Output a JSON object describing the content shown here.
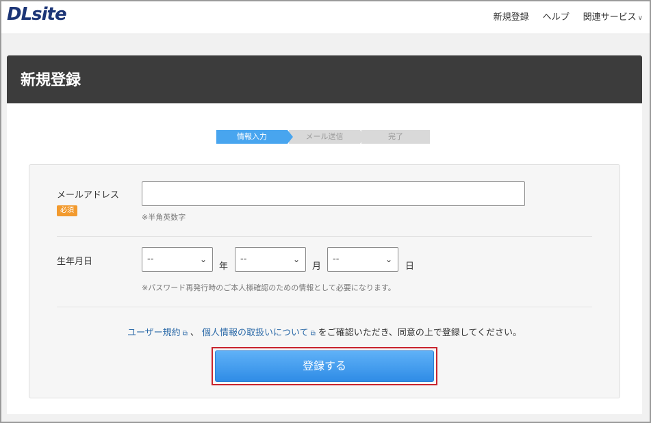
{
  "header": {
    "logo": "DLsite",
    "nav": [
      "新規登録",
      "ヘルプ",
      "関連サービス"
    ]
  },
  "page": {
    "title": "新規登録",
    "steps": [
      "情報入力",
      "メール送信",
      "完了"
    ],
    "active_step": 0
  },
  "form": {
    "email": {
      "label": "メールアドレス",
      "required_badge": "必須",
      "value": "",
      "hint": "※半角英数字"
    },
    "birthday": {
      "label": "生年月日",
      "year_value": "--",
      "year_unit": "年",
      "month_value": "--",
      "month_unit": "月",
      "day_value": "--",
      "day_unit": "日",
      "hint": "※パスワード再発行時のご本人様確認のための情報として必要になります。"
    },
    "agreement": {
      "terms_link": "ユーザー規約",
      "separator": "、",
      "privacy_link": "個人情報の取扱いについて",
      "rest": "をご確認いただき、同意の上で登録してください。"
    },
    "submit_label": "登録する"
  },
  "colors": {
    "accent": "#48a5ef",
    "required": "#f29a2e",
    "highlight_border": "#c8232c",
    "title_bar": "#3c3c3c"
  }
}
